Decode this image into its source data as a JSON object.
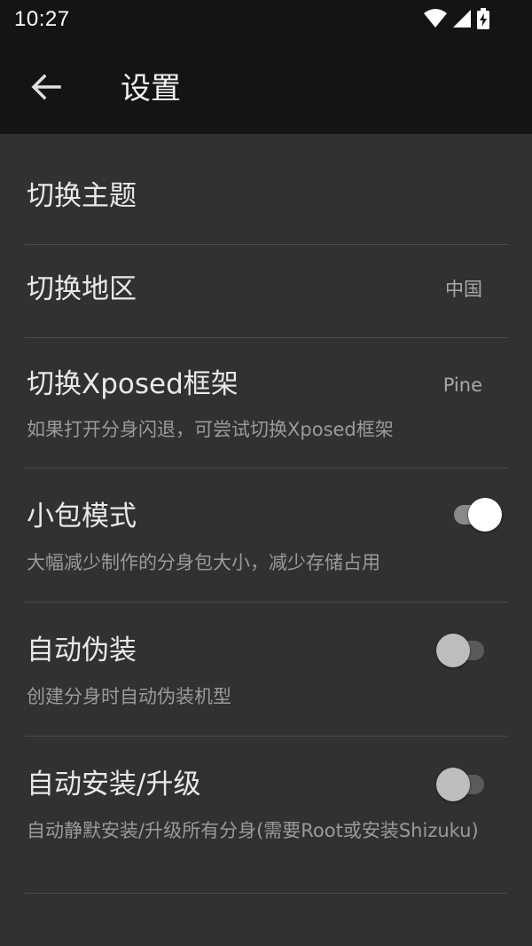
{
  "status_bar": {
    "time": "10:27",
    "icons": [
      "wifi-icon",
      "cell-signal-icon",
      "battery-charging-icon"
    ]
  },
  "toolbar": {
    "title": "设置",
    "back_icon": "arrow-left-icon"
  },
  "settings": [
    {
      "title": "切换主题",
      "subtitle": "",
      "value": ""
    },
    {
      "title": "切换地区",
      "subtitle": "",
      "value": "中国"
    },
    {
      "title": "切换Xposed框架",
      "subtitle": "如果打开分身闪退，可尝试切换Xposed框架",
      "value": "Pine"
    },
    {
      "title": "小包模式",
      "subtitle": "大幅减少制作的分身包大小，减少存储占用",
      "toggle": true
    },
    {
      "title": "自动伪装",
      "subtitle": "创建分身时自动伪装机型",
      "toggle": false
    },
    {
      "title": "自动安装/升级",
      "subtitle": "自动静默安装/升级所有分身(需要Root或安装Shizuku)",
      "toggle": false
    }
  ],
  "colors": {
    "background": "#313131",
    "toolbar": "#141414",
    "divider": "#4b4b4b",
    "toggle_on_thumb": "#ffffff",
    "toggle_off_thumb": "#bdbdbd"
  }
}
